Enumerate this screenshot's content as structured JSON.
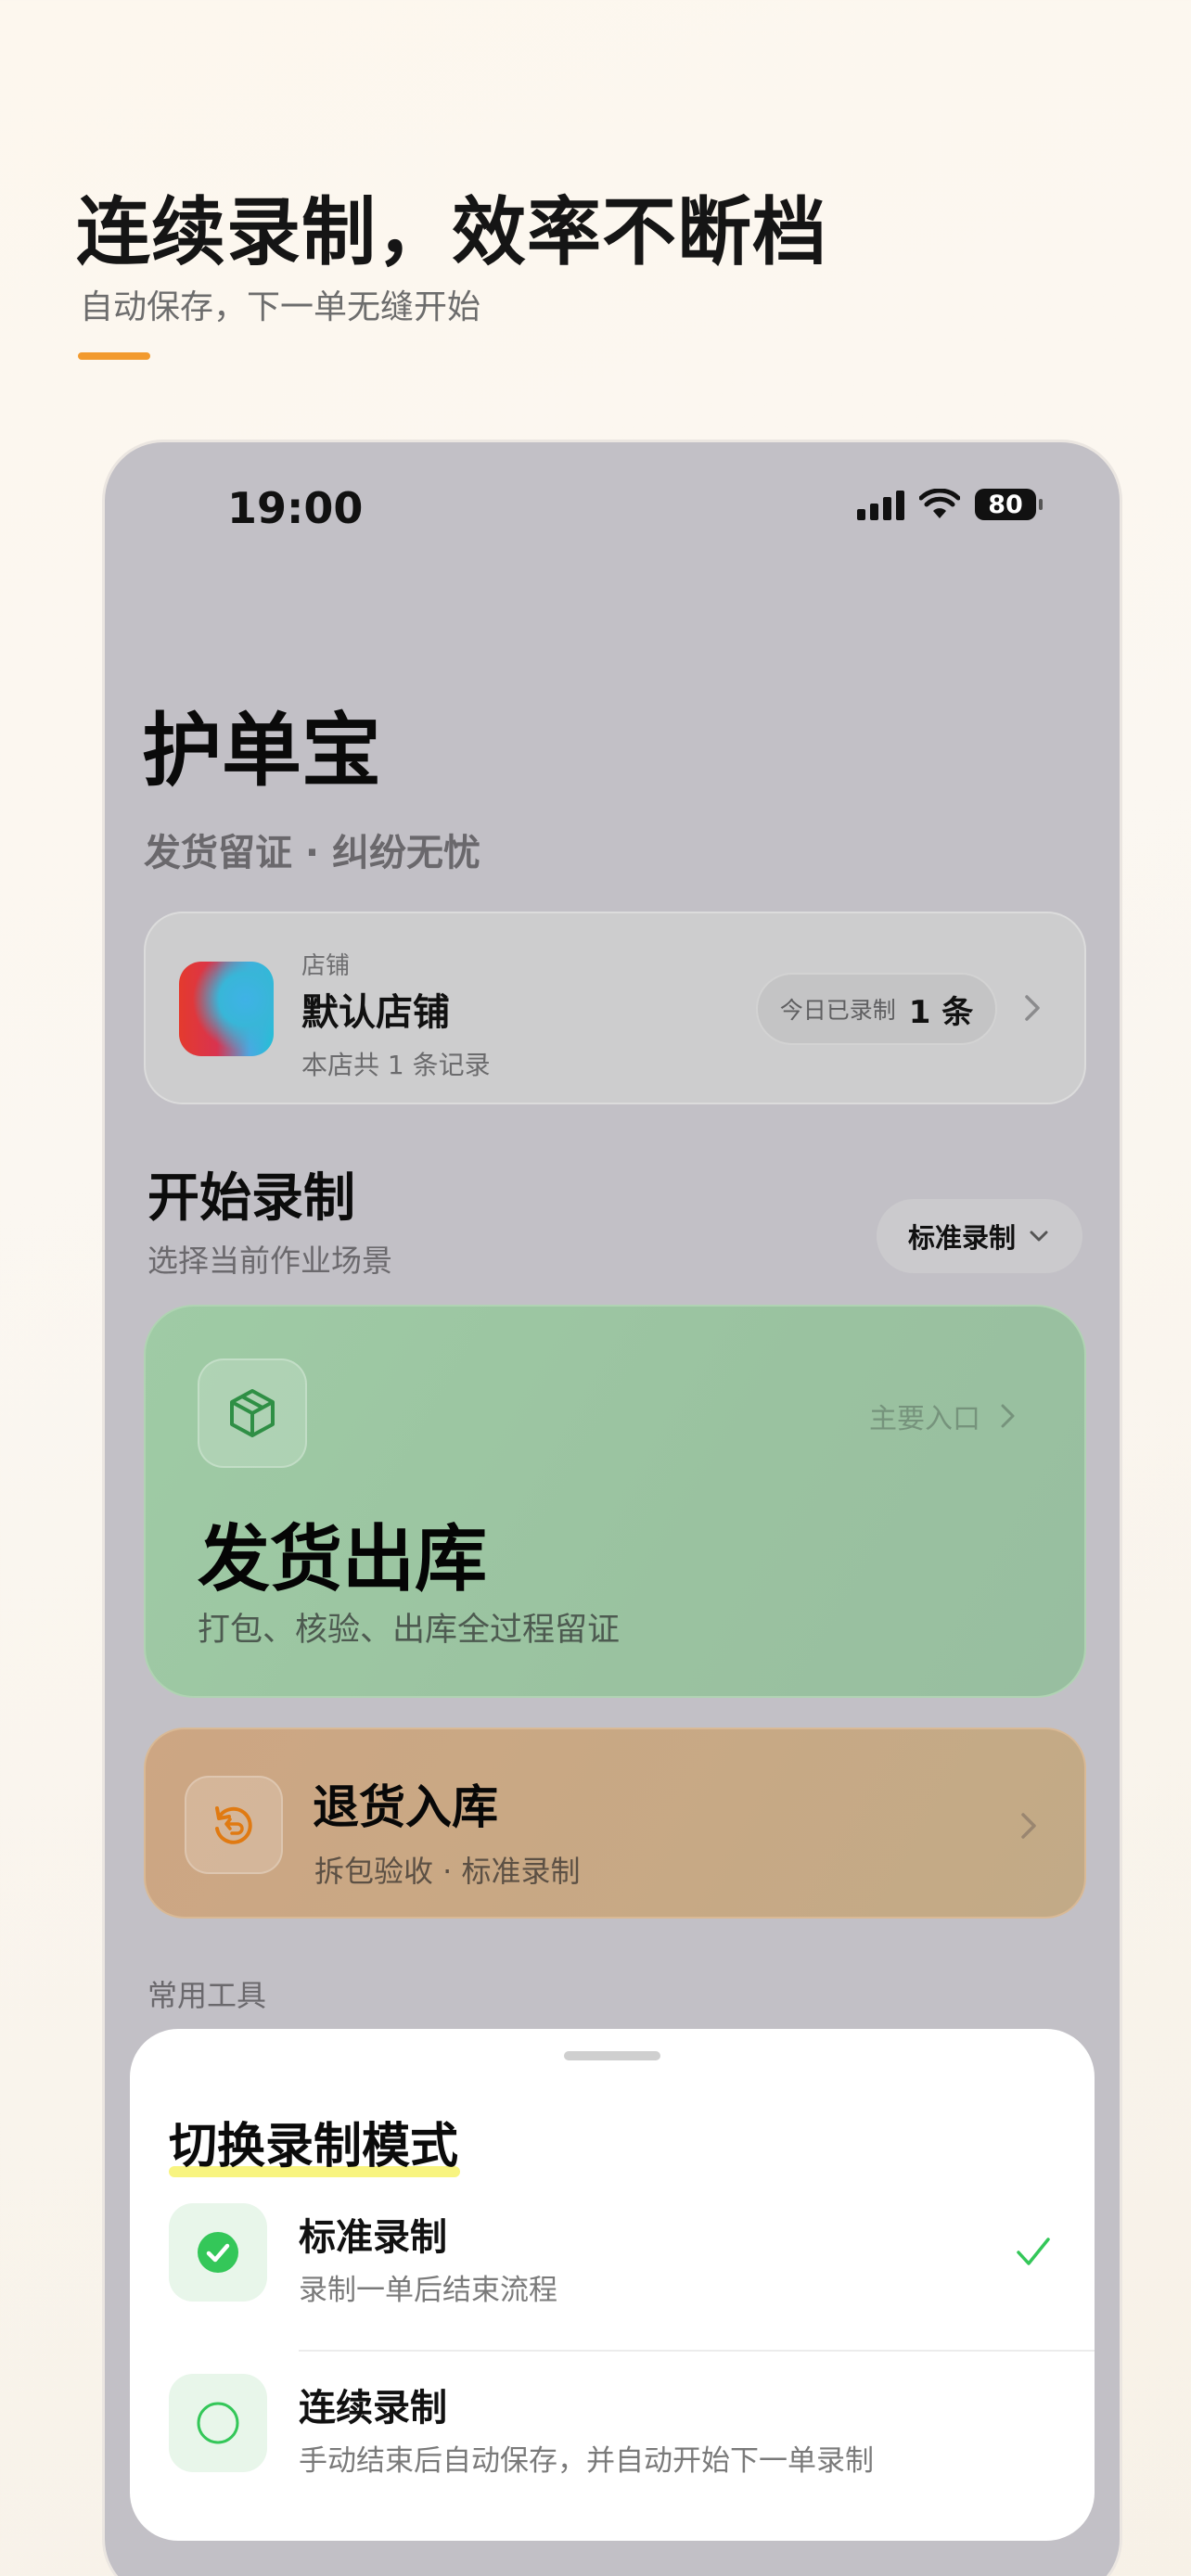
{
  "promo": {
    "title": "连续录制，效率不断档",
    "subtitle": "自动保存，下一单无缝开始"
  },
  "status_bar": {
    "time": "19:00",
    "battery": "80"
  },
  "app": {
    "title": "护单宝",
    "subtitle": "发货留证 · 纠纷无忧"
  },
  "store": {
    "kicker": "店铺",
    "name": "默认店铺",
    "meta": "本店共 1 条记录",
    "today_label": "今日已录制",
    "today_count": "1 条"
  },
  "start_section": {
    "title": "开始录制",
    "subtitle": "选择当前作业场景",
    "mode_label": "标准录制"
  },
  "ship_card": {
    "entry_label": "主要入口",
    "title": "发货出库",
    "subtitle": "打包、核验、出库全过程留证"
  },
  "return_card": {
    "title": "退货入库",
    "subtitle": "拆包验收 · 标准录制"
  },
  "tools_label": "常用工具",
  "sheet": {
    "title": "切换录制模式",
    "options": [
      {
        "title": "标准录制",
        "description": "录制一单后结束流程",
        "selected": true
      },
      {
        "title": "连续录制",
        "description": "手动结束后自动保存，并自动开始下一单录制",
        "selected": false
      }
    ]
  },
  "colors": {
    "accent_orange": "#f29a2e",
    "success_green": "#34c759",
    "ship_green": "#9fcba5",
    "return_tan": "#cda683"
  },
  "icons": [
    "signal-icon",
    "wifi-icon",
    "battery-icon",
    "chevron-right-icon",
    "chevron-down-icon",
    "package-icon",
    "return-icon",
    "check-circle-icon",
    "empty-circle-icon",
    "checkmark-icon"
  ]
}
